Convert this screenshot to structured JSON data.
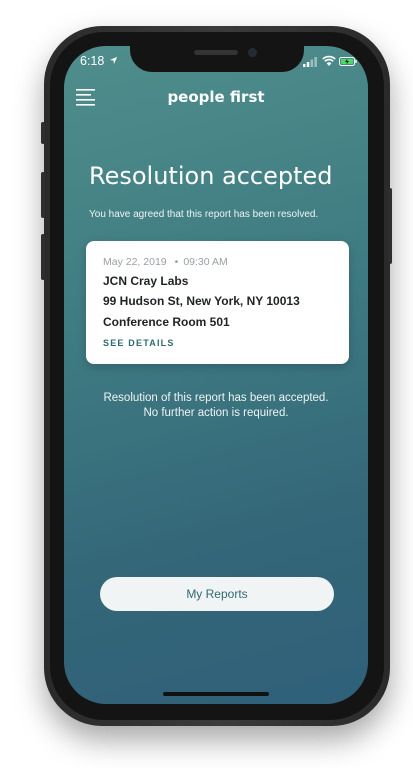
{
  "status_bar": {
    "time": "6:18"
  },
  "header": {
    "brand": "people first"
  },
  "main": {
    "title": "Resolution accepted",
    "subtitle": "You have agreed that this report has been resolved."
  },
  "report_card": {
    "date": "May 22, 2019",
    "separator": "•",
    "time": "09:30 AM",
    "company": "JCN Cray Labs",
    "address": "99 Hudson St, New York, NY 10013",
    "room": "Conference Room 501",
    "details_link": "SEE DETAILS"
  },
  "message": {
    "line1": "Resolution of this report has been accepted.",
    "line2": "No further action is required."
  },
  "actions": {
    "my_reports": "My Reports"
  },
  "colors": {
    "accent": "#2f6b72",
    "screen_top": "#4f8e8c",
    "screen_bottom": "#30607a",
    "card_bg": "#ffffff",
    "button_bg": "#f1f4f4"
  },
  "icons": [
    "location-arrow-icon",
    "signal-icon",
    "wifi-icon",
    "battery-charging-icon",
    "hamburger-menu-icon"
  ]
}
